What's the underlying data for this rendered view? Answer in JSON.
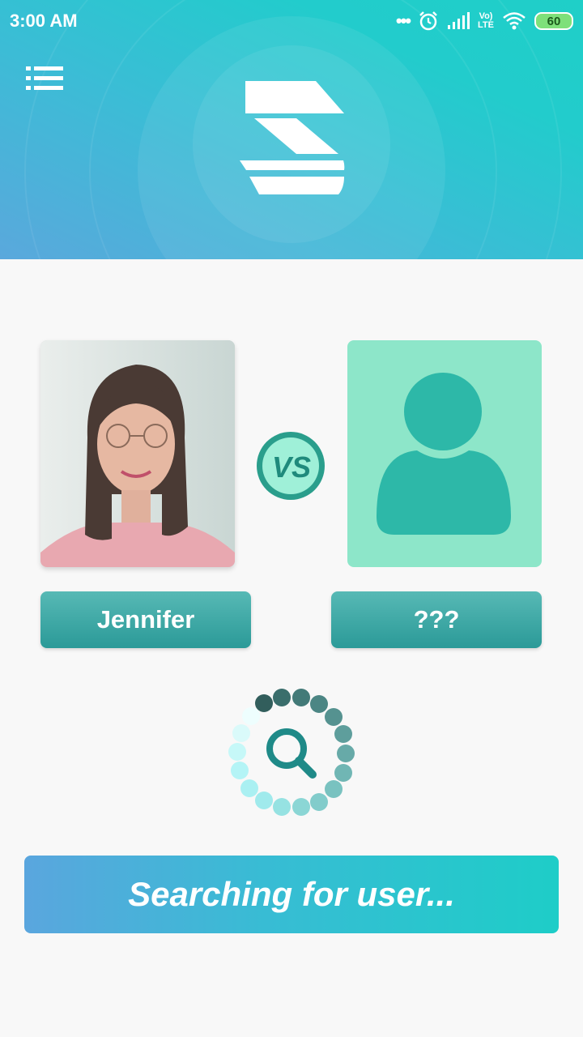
{
  "status_bar": {
    "time": "3:00 AM",
    "network_label_top": "Vo)",
    "network_label_bottom": "LTE",
    "battery": "60"
  },
  "header": {
    "menu_icon": "list-menu-icon",
    "logo_icon": "app-logo"
  },
  "versus": {
    "label": "VS",
    "player": {
      "name": "Jennifer",
      "avatar": "user-photo"
    },
    "opponent": {
      "name": "???",
      "avatar": "person-placeholder-icon"
    }
  },
  "search": {
    "spinner_icon": "magnifier-icon",
    "status_text": "Searching for user..."
  },
  "colors": {
    "accent_teal": "#2b9a98",
    "placeholder_bg": "#8de6c9",
    "placeholder_fg": "#2db8a8",
    "gradient_start": "#5aa6de",
    "gradient_end": "#1ecdc8"
  }
}
